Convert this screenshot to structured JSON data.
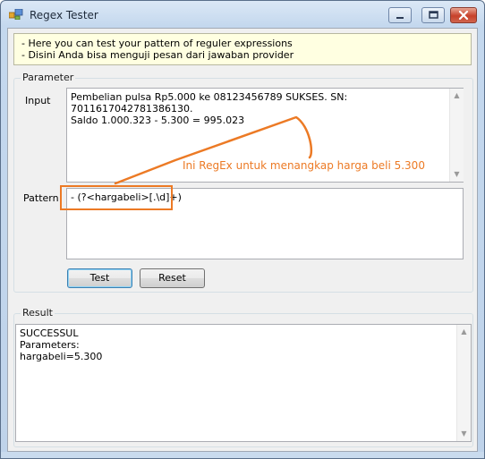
{
  "window": {
    "title": "Regex Tester"
  },
  "info": {
    "line1": "- Here you can test your pattern of reguler expressions",
    "line2": "- Disini Anda bisa menguji pesan dari jawaban provider"
  },
  "parameter": {
    "group_title": "Parameter",
    "input_label": "Input",
    "input_value": "Pembelian pulsa Rp5.000 ke 08123456789 SUKSES. SN: 7011617042781386130.\nSaldo 1.000.323 - 5.300 = 995.023",
    "pattern_label": "Pattern",
    "pattern_value": "- (?<hargabeli>[.\\d]+)",
    "test_button": "Test",
    "reset_button": "Reset"
  },
  "annotation": {
    "text": "Ini RegEx untuk menangkap harga beli 5.300",
    "color": "#ec7a25"
  },
  "result": {
    "group_title": "Result",
    "text": "SUCCESSUL\nParameters:\nhargabeli=5.300"
  },
  "icons": {
    "app": "app-icon",
    "minimize": "minimize-icon",
    "maximize": "maximize-icon",
    "close": "close-icon"
  }
}
